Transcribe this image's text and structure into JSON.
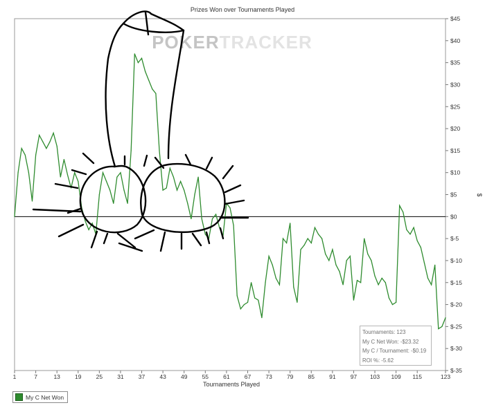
{
  "chart_data": {
    "type": "line",
    "title": "Prizes Won over Tournaments Played",
    "xlabel": "Tournaments Played",
    "ylabel": "$",
    "watermark": "POKERTRACKER",
    "x_ticks": [
      "1",
      "7",
      "13",
      "19",
      "25",
      "31",
      "37",
      "43",
      "49",
      "55",
      "61",
      "67",
      "73",
      "79",
      "85",
      "91",
      "97",
      "103",
      "109",
      "115",
      "123"
    ],
    "y_ticks": [
      "$45",
      "$40",
      "$35",
      "$30",
      "$25",
      "$20",
      "$15",
      "$10",
      "$5",
      "$0",
      "$-5",
      "$-10",
      "$-15",
      "$-20",
      "$-25",
      "$-30",
      "$-35"
    ],
    "xlim": [
      1,
      123
    ],
    "ylim": [
      -35,
      45
    ],
    "grid": false,
    "legend_position": "bottom-left",
    "series": [
      {
        "name": "My C Net Won",
        "color": "#2e8b2e",
        "x": [
          1,
          2,
          3,
          4,
          5,
          6,
          7,
          8,
          9,
          10,
          11,
          12,
          13,
          14,
          15,
          16,
          17,
          18,
          19,
          20,
          21,
          22,
          23,
          24,
          25,
          26,
          27,
          28,
          29,
          30,
          31,
          32,
          33,
          34,
          35,
          36,
          37,
          38,
          39,
          40,
          41,
          42,
          43,
          44,
          45,
          46,
          47,
          48,
          49,
          50,
          51,
          52,
          53,
          54,
          55,
          56,
          57,
          58,
          59,
          60,
          61,
          62,
          63,
          64,
          65,
          66,
          67,
          68,
          69,
          70,
          71,
          72,
          73,
          74,
          75,
          76,
          77,
          78,
          79,
          80,
          81,
          82,
          83,
          84,
          85,
          86,
          87,
          88,
          89,
          90,
          91,
          92,
          93,
          94,
          95,
          96,
          97,
          98,
          99,
          100,
          101,
          102,
          103,
          104,
          105,
          106,
          107,
          108,
          109,
          110,
          111,
          112,
          113,
          114,
          115,
          116,
          117,
          118,
          119,
          120,
          121,
          122,
          123
        ],
        "values": [
          0,
          10,
          15.5,
          14,
          10,
          3.5,
          14,
          18.5,
          17,
          15.5,
          17,
          19,
          16,
          9,
          13,
          9.5,
          6.5,
          10,
          8,
          2,
          -1,
          -3,
          -1.5,
          -4,
          5,
          10,
          8,
          6,
          3,
          9,
          10,
          6,
          3,
          15,
          37,
          35,
          36,
          33,
          31,
          29,
          28,
          15,
          6,
          6.5,
          11,
          9,
          6,
          8,
          6,
          3,
          -0.5,
          5,
          9,
          -0.5,
          -4,
          -5,
          -0.5,
          0.5,
          -2.5,
          -4.5,
          3,
          2,
          -2,
          -18,
          -21,
          -20,
          -19.5,
          -15,
          -18.5,
          -19,
          -23,
          -15,
          -9,
          -11,
          -14,
          -15.5,
          -5,
          -6,
          -1.5,
          -16,
          -19.5,
          -7.5,
          -6.5,
          -5,
          -6,
          -2.5,
          -4,
          -5,
          -8.5,
          -10,
          -7.5,
          -11,
          -12.5,
          -15.5,
          -10,
          -9,
          -19,
          -14.5,
          -15,
          -5,
          -8.5,
          -10,
          -13.5,
          -15.5,
          -14,
          -15,
          -18.5,
          -20,
          -19.5,
          2.5,
          1,
          -3,
          -4,
          -2.5,
          -5.5,
          -7,
          -10.5,
          -14,
          -15.5,
          -11,
          -25.5,
          -25,
          -23
        ]
      }
    ],
    "stats": [
      "Tournaments: 123",
      "My C Net Won: -$23.32",
      "My C / Tournament: -$0.19",
      "ROI %: -5.62"
    ],
    "legend_label": "My C Net Won"
  }
}
